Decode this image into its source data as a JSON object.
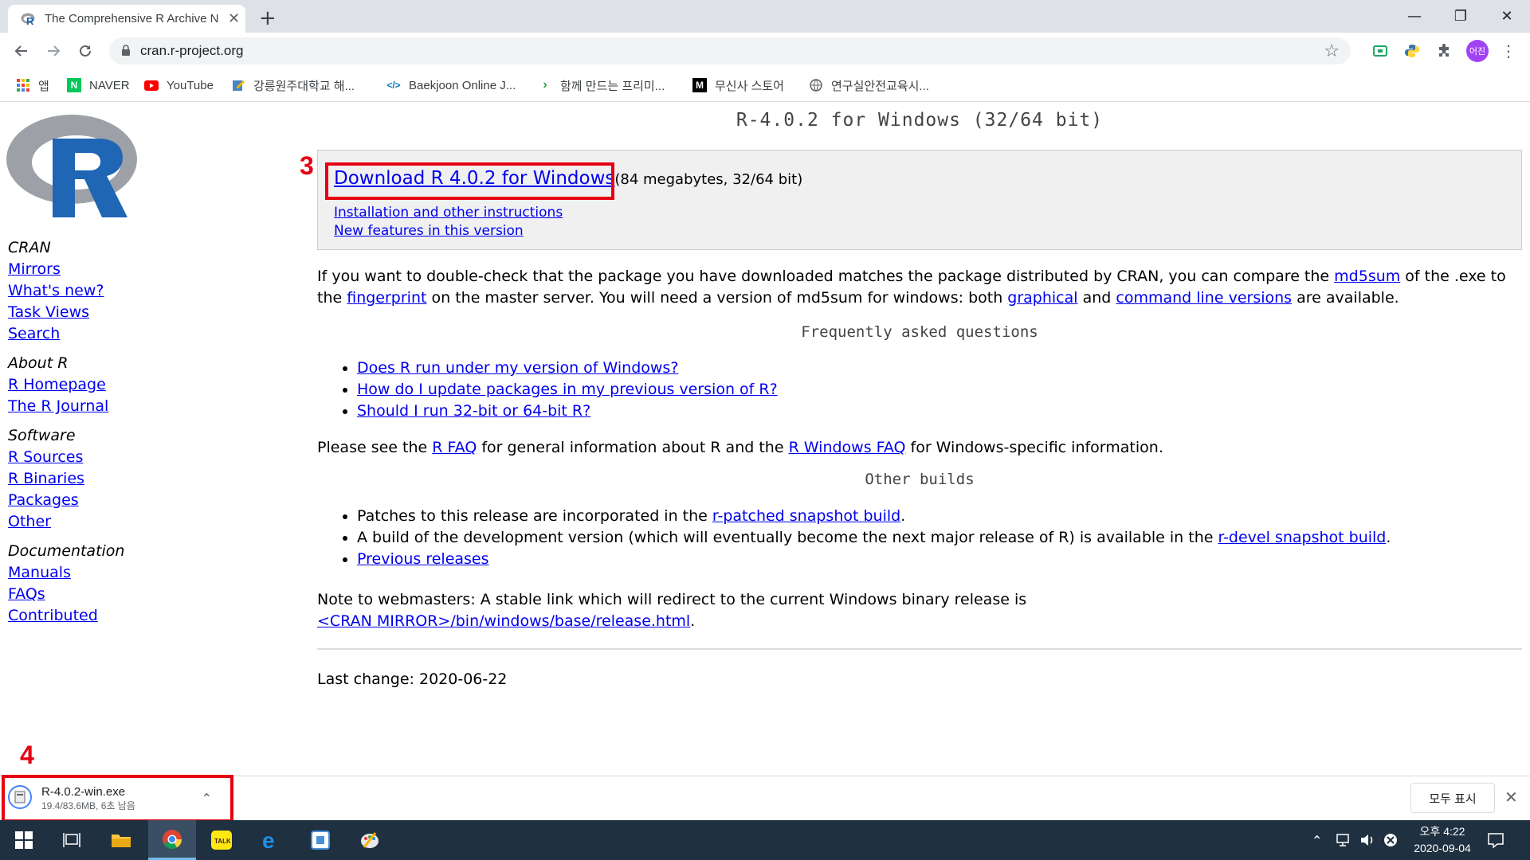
{
  "browser": {
    "tab_title": "The Comprehensive R Archive N",
    "new_tab": "+",
    "url": "cran.r-project.org",
    "profile_initials": "어진",
    "window_controls": {
      "minimize": "—",
      "restore": "❐",
      "close": "✕"
    }
  },
  "bookmarks": [
    {
      "label": "앱",
      "icon": "apps-grid-icon"
    },
    {
      "label": "NAVER",
      "icon": "naver-icon"
    },
    {
      "label": "YouTube",
      "icon": "youtube-icon"
    },
    {
      "label": "강릉원주대학교 해...",
      "icon": "edit-icon"
    },
    {
      "label": "Baekjoon Online J...",
      "icon": "code-icon"
    },
    {
      "label": "함께 만드는 프리미...",
      "icon": "arrow-icon"
    },
    {
      "label": "무신사 스토어",
      "icon": "musinsa-icon"
    },
    {
      "label": "연구실안전교육시...",
      "icon": "globe-icon"
    }
  ],
  "sidebar": {
    "sections": [
      {
        "title": "CRAN",
        "links": [
          "Mirrors",
          "What's new?",
          "Task Views",
          "Search"
        ]
      },
      {
        "title": "About R",
        "links": [
          "R Homepage",
          "The R Journal"
        ]
      },
      {
        "title": "Software",
        "links": [
          "R Sources",
          "R Binaries",
          "Packages",
          "Other"
        ]
      },
      {
        "title": "Documentation",
        "links": [
          "Manuals",
          "FAQs",
          "Contributed"
        ]
      }
    ]
  },
  "main": {
    "heading": "R-4.0.2 for Windows (32/64 bit)",
    "download_link": "Download R 4.0.2 for Windows",
    "download_meta": "(84 megabytes, 32/64 bit)",
    "install_link": "Installation and other instructions",
    "features_link": "New features in this version",
    "p1_a": "If you want to double-check that the package you have downloaded matches the package distributed by CRAN, you can compare the ",
    "p1_link1": "md5sum",
    "p1_b": " of the .exe to the ",
    "p1_link2": "fingerprint",
    "p1_c": " on the master server. You will need a version of md5sum for windows: both ",
    "p1_link3": "graphical",
    "p1_d": " and ",
    "p1_link4": "command line versions",
    "p1_e": " are available.",
    "faq_heading": "Frequently asked questions",
    "faq": [
      "Does R run under my version of Windows?",
      "How do I update packages in my previous version of R?",
      "Should I run 32-bit or 64-bit R?"
    ],
    "p2_a": "Please see the ",
    "p2_link1": "R FAQ",
    "p2_b": " for general information about R and the ",
    "p2_link2": "R Windows FAQ",
    "p2_c": " for Windows-specific information.",
    "other_heading": "Other builds",
    "ob1_a": "Patches to this release are incorporated in the ",
    "ob1_link": "r-patched snapshot build",
    "ob1_b": ".",
    "ob2_a": "A build of the development version (which will eventually become the next major release of R) is available in the ",
    "ob2_link": "r-devel snapshot build",
    "ob2_b": ".",
    "ob3_link": "Previous releases",
    "note_text": "Note to webmasters: A stable link which will redirect to the current Windows binary release is",
    "note_link": "<CRAN MIRROR>/bin/windows/base/release.html",
    "note_end": ".",
    "last_change": "Last change: 2020-06-22"
  },
  "annotations": {
    "step3": "3",
    "step4": "4",
    "color": "#e60012"
  },
  "download_bar": {
    "filename": "R-4.0.2-win.exe",
    "status": "19.4/83.6MB, 6초 남음",
    "show_all": "모두 표시"
  },
  "taskbar": {
    "time": "오후 4:22",
    "date": "2020-09-04"
  }
}
